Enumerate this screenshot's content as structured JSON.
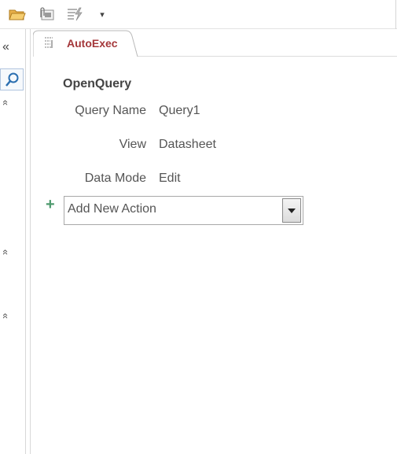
{
  "qat": {
    "icons": [
      "open-folder-icon",
      "attachment-icon",
      "run-macro-icon",
      "customize-dropdown-icon"
    ],
    "dropdown_glyph": "▾"
  },
  "nav": {
    "collapse_glyph": "«",
    "chevron_glyph": "«"
  },
  "tab": {
    "label": "AutoExec",
    "label_color": "#a4373a"
  },
  "action": {
    "name": "OpenQuery",
    "arguments": [
      {
        "label": "Query Name",
        "value": "Query1"
      },
      {
        "label": "View",
        "value": "Datasheet"
      },
      {
        "label": "Data Mode",
        "value": "Edit"
      }
    ]
  },
  "add_action": {
    "plus_glyph": "+",
    "value": "Add New Action",
    "accent": "#4e9a6e"
  }
}
